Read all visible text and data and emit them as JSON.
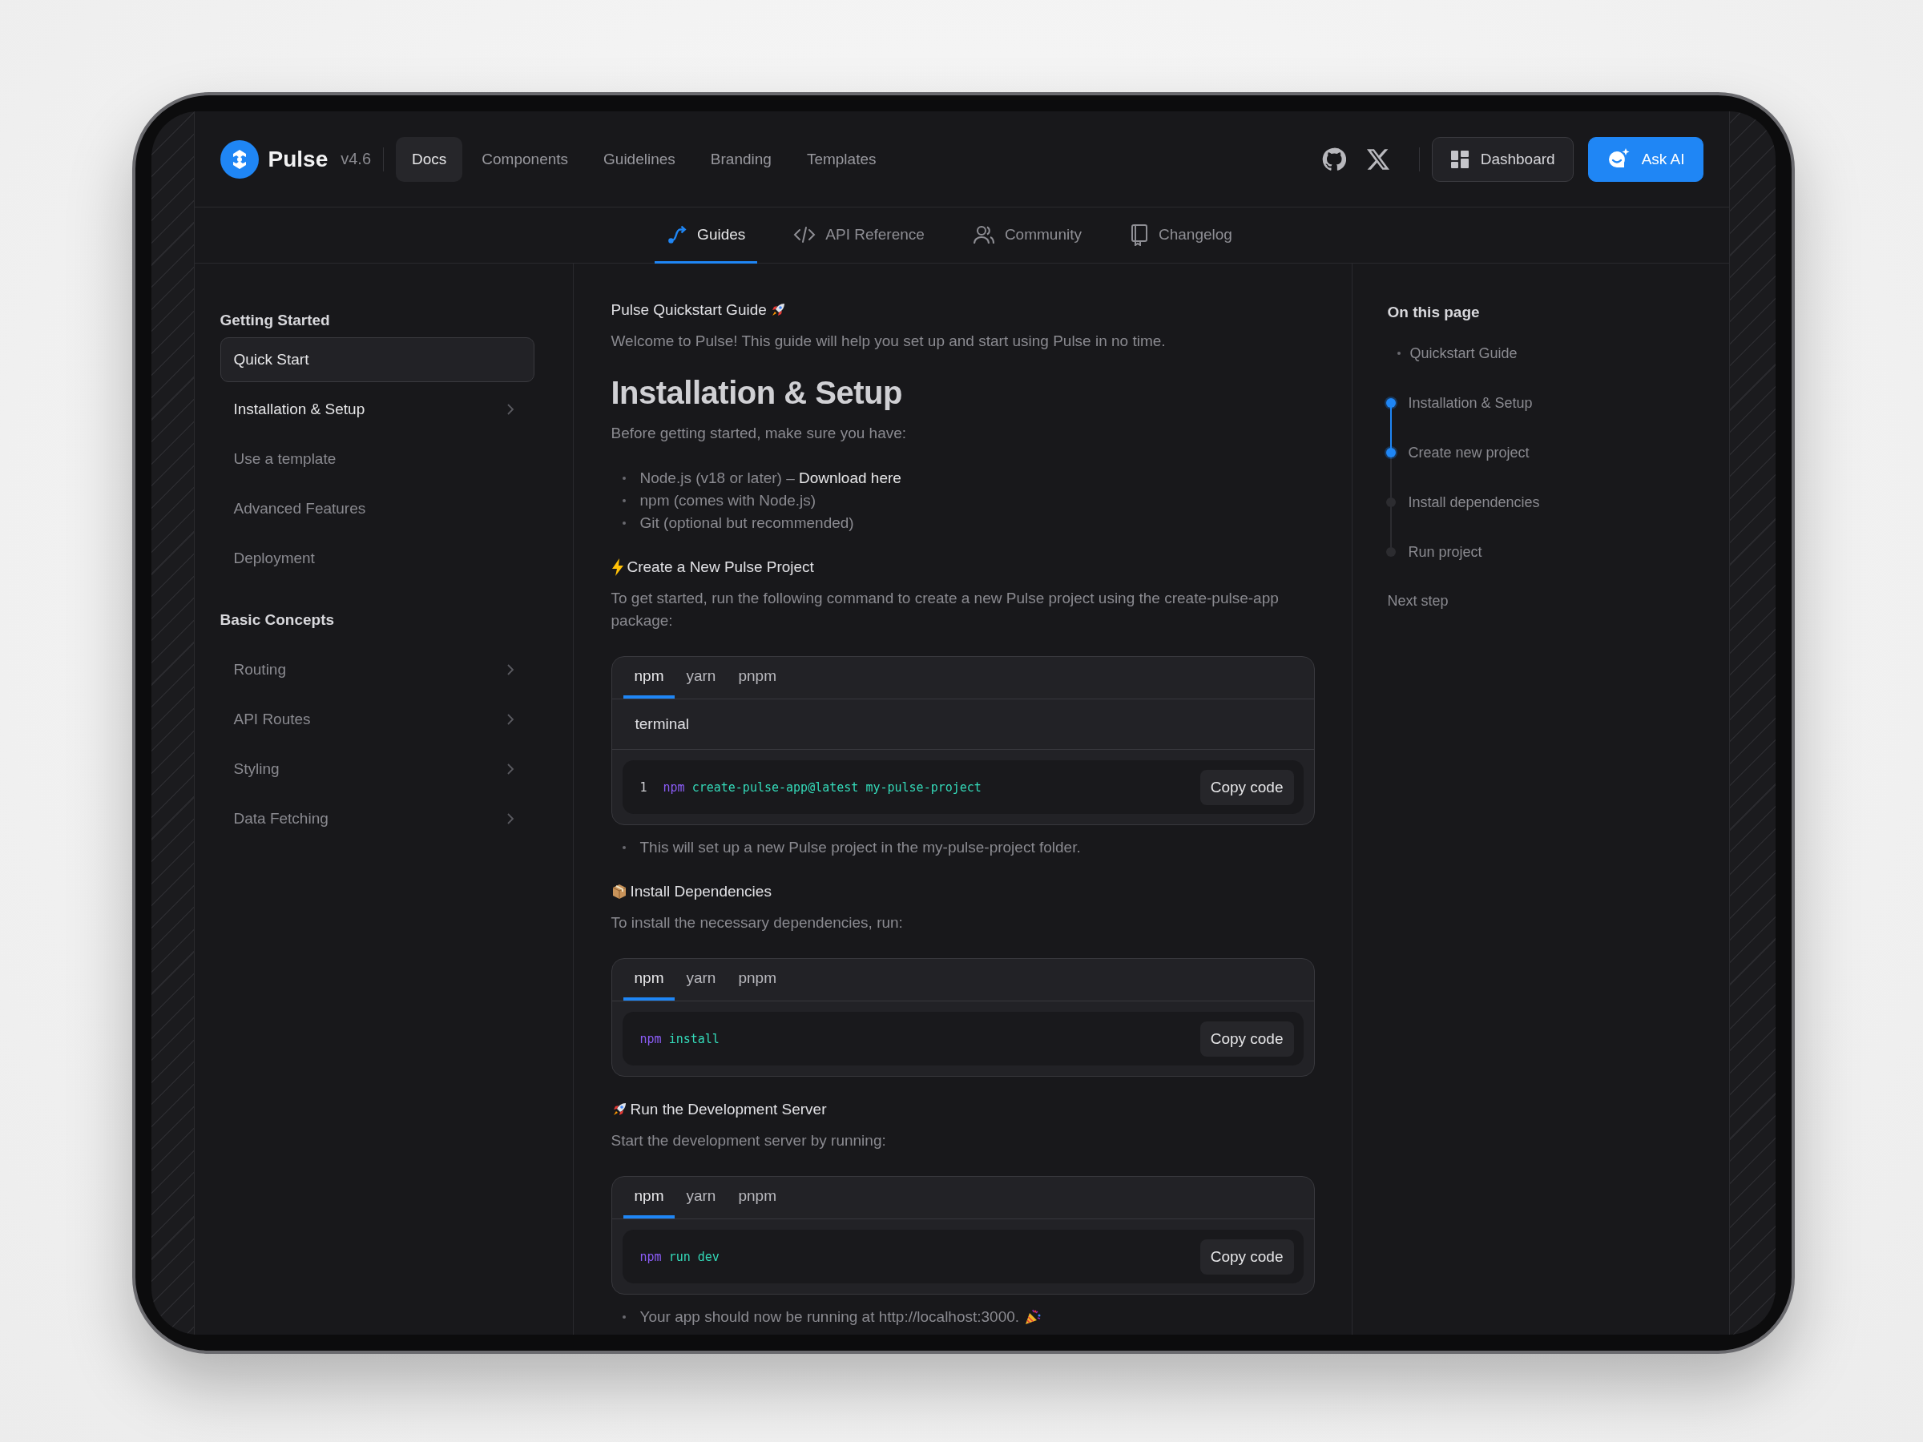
{
  "header": {
    "brand": "Pulse",
    "version": "v4.6",
    "nav": [
      {
        "label": "Docs",
        "selected": true
      },
      {
        "label": "Components",
        "selected": false
      },
      {
        "label": "Guidelines",
        "selected": false
      },
      {
        "label": "Branding",
        "selected": false
      },
      {
        "label": "Templates",
        "selected": false
      }
    ],
    "buttons": [
      {
        "label": "Dashboard",
        "kind": "secondary"
      },
      {
        "label": "Ask AI",
        "kind": "primary"
      }
    ]
  },
  "subnav": [
    {
      "label": "Guides",
      "selected": true
    },
    {
      "label": "API Reference",
      "selected": false
    },
    {
      "label": "Community",
      "selected": false
    },
    {
      "label": "Changelog",
      "selected": false
    }
  ],
  "sidebar": [
    {
      "title": "Getting Started",
      "items": [
        {
          "label": "Quick Start",
          "selected": true,
          "highlighted": true,
          "expandable": false
        },
        {
          "label": "Installation & Setup",
          "selected": false,
          "highlighted": true,
          "expandable": true
        },
        {
          "label": "Use a template",
          "selected": false,
          "highlighted": false,
          "expandable": false
        },
        {
          "label": "Advanced Features",
          "selected": false,
          "highlighted": false,
          "expandable": false
        },
        {
          "label": "Deployment",
          "selected": false,
          "highlighted": false,
          "expandable": false
        }
      ]
    },
    {
      "title": "Basic Concepts",
      "items": [
        {
          "label": "Routing",
          "selected": false,
          "highlighted": false,
          "expandable": true
        },
        {
          "label": "API Routes",
          "selected": false,
          "highlighted": false,
          "expandable": true
        },
        {
          "label": "Styling",
          "selected": false,
          "highlighted": false,
          "expandable": true
        },
        {
          "label": "Data Fetching",
          "selected": false,
          "highlighted": false,
          "expandable": true
        }
      ]
    }
  ],
  "content": [
    {
      "kind": "eyebrow",
      "text": "Pulse Quickstart Guide"
    },
    {
      "kind": "lead",
      "text": "Welcome to Pulse! This guide will help you set up and start using Pulse in no time."
    },
    {
      "kind": "title",
      "text": "Installation & Setup"
    },
    {
      "kind": "paragraph",
      "text": "Before getting started, make sure you have:"
    },
    {
      "kind": "bullets",
      "items": [
        {
          "text": "Node.js (v18 or later) – ",
          "link": "Download here"
        },
        {
          "text": "npm (comes with Node.js)"
        },
        {
          "text": "Git (optional but recommended)"
        }
      ]
    },
    {
      "kind": "heading",
      "text": "Create a New Pulse Project"
    },
    {
      "kind": "paragraph",
      "text": "To get started, run the following command to create a new Pulse project using the create-pulse-app package:"
    },
    {
      "kind": "code",
      "tabs": [
        {
          "label": "npm",
          "selected": true
        },
        {
          "label": "yarn",
          "selected": false
        },
        {
          "label": "pnpm",
          "selected": false
        }
      ],
      "filename": "terminal",
      "lines": [
        {
          "number": "1",
          "tokens": [
            {
              "text": "npm",
              "kind": "command"
            },
            {
              "text": "create-pulse-app@latest my-pulse-project",
              "kind": "argument"
            }
          ]
        }
      ],
      "copy": "Copy code"
    },
    {
      "kind": "bullets",
      "items": [
        {
          "text": "This will set up a new Pulse project in the my-pulse-project folder."
        }
      ]
    },
    {
      "kind": "heading",
      "text": "Install Dependencies"
    },
    {
      "kind": "paragraph",
      "text": "To install the necessary dependencies, run:"
    },
    {
      "kind": "code",
      "tabs": [
        {
          "label": "npm",
          "selected": true
        },
        {
          "label": "yarn",
          "selected": false
        },
        {
          "label": "pnpm",
          "selected": false
        }
      ],
      "lines": [
        {
          "tokens": [
            {
              "text": "npm",
              "kind": "command"
            },
            {
              "text": "install",
              "kind": "argument"
            }
          ]
        }
      ],
      "copy": "Copy code"
    },
    {
      "kind": "heading",
      "text": "Run the Development Server"
    },
    {
      "kind": "paragraph",
      "text": "Start the development server by running:"
    },
    {
      "kind": "code",
      "tabs": [
        {
          "label": "npm",
          "selected": true
        },
        {
          "label": "yarn",
          "selected": false
        },
        {
          "label": "pnpm",
          "selected": false
        }
      ],
      "lines": [
        {
          "tokens": [
            {
              "text": "npm",
              "kind": "command"
            },
            {
              "text": "run dev",
              "kind": "argument"
            }
          ]
        }
      ],
      "copy": "Copy code"
    },
    {
      "kind": "bullets",
      "items": [
        {
          "text": "Your app should now be running at http://localhost:3000."
        }
      ]
    }
  ],
  "toc": {
    "title": "On this page",
    "items": [
      {
        "label": "Quickstart Guide",
        "kind": "plain"
      },
      {
        "label": "Installation & Setup",
        "kind": "step",
        "active": true
      },
      {
        "label": "Create new project",
        "kind": "step",
        "active": true
      },
      {
        "label": "Install dependencies",
        "kind": "step",
        "active": false
      },
      {
        "label": "Run project",
        "kind": "step",
        "active": false
      }
    ],
    "footer": "Next step"
  }
}
